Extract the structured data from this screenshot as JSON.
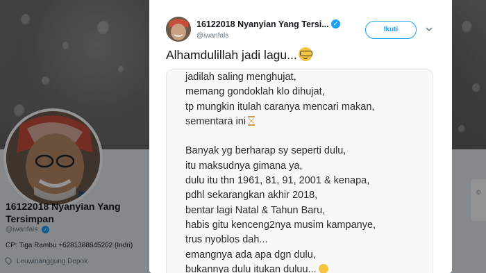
{
  "profile": {
    "name": "16122018 Nyanyian Yang Tersimpan",
    "handle": "@iwanfals",
    "bio": "CP: Tiga Rambu +6281388845202 (Indri)",
    "location": "Leuwinanggung Depok"
  },
  "tweet": {
    "author_name": "16122018 Nyanyian Yang Tersi...",
    "author_handle": "@iwanfals",
    "follow_label": "Ikuti",
    "text": "Alhamdulillah jadi lagu...",
    "text_emoji": "nerd-face-emoji",
    "poem_lines": [
      "jadilah saling menghujat,",
      "memang gondoklah klo dihujat,",
      "tp mungkin itulah caranya mencari makan,",
      "sementara ini",
      "",
      "Banyak yg berharap sy seperti dulu,",
      "itu maksudnya gimana ya,",
      "dulu itu thn 1961, 81, 91, 2001 & kenapa,",
      "pdhl sekarangkan akhir 2018,",
      "bentar lagi Natal & Tahun Baru,",
      "habis gitu kenceng2nya musim kampanye,",
      "trus nyoblos dah...",
      "emangnya ada apa dgn dulu,",
      "bukannya dulu itukan duluu..."
    ]
  },
  "right_fragment": "©",
  "colors": {
    "accent": "#1da1f2",
    "text": "#14171a",
    "muted": "#657786"
  }
}
